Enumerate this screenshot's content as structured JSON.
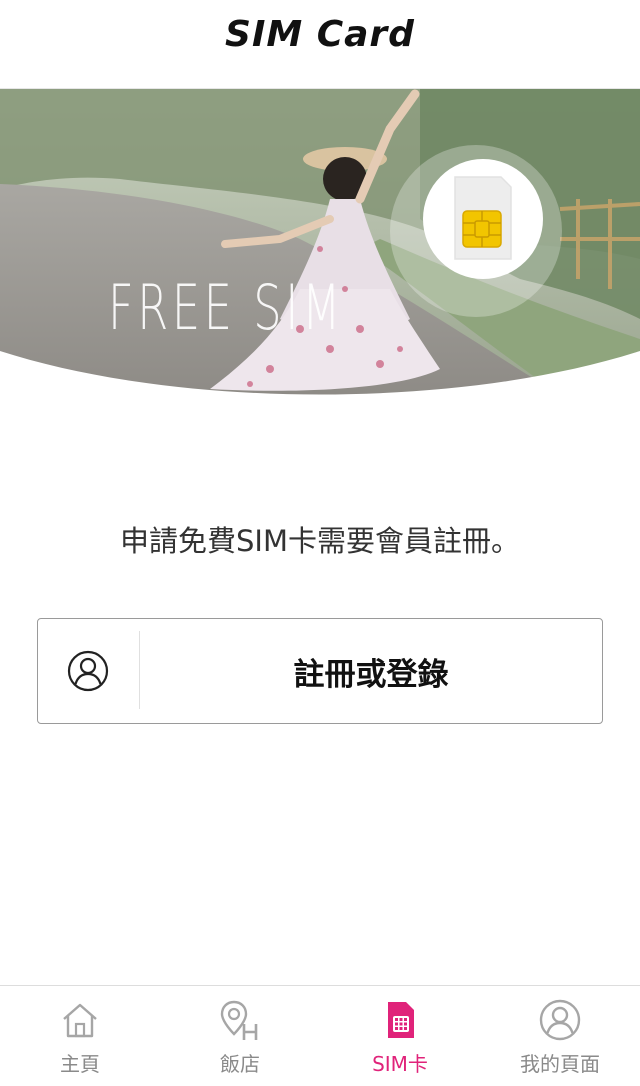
{
  "header": {
    "title": "SIM Card"
  },
  "banner": {
    "text": "FREE SIM"
  },
  "main": {
    "message": "申請免費SIM卡需要會員註冊。",
    "login_button_label": "註冊或登錄"
  },
  "tabbar": {
    "items": [
      {
        "label": "主頁",
        "icon": "home-icon",
        "active": false
      },
      {
        "label": "飯店",
        "icon": "hotel-pin-icon",
        "active": false
      },
      {
        "label": "SIM卡",
        "icon": "sim-card-icon",
        "active": true
      },
      {
        "label": "我的頁面",
        "icon": "profile-icon",
        "active": false
      }
    ]
  },
  "colors": {
    "accent": "#e0237a",
    "sim_chip": "#f2c500",
    "inactive": "#8a8a8a"
  }
}
